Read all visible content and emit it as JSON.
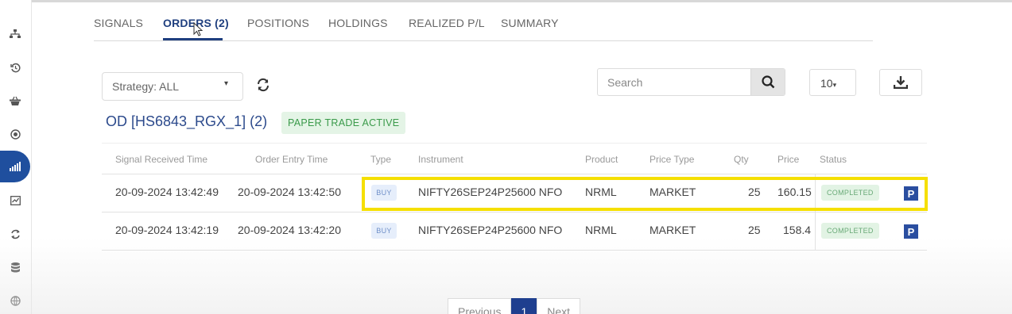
{
  "sidebar": {
    "icons": [
      "sitemap-icon",
      "history-icon",
      "basket-icon",
      "target-icon",
      "signal-bars-icon",
      "chart-box-icon",
      "sync-icon",
      "database-icon",
      "globe-icon"
    ],
    "active_index": 4
  },
  "tabs": [
    {
      "label": "SIGNALS"
    },
    {
      "label": "ORDERS (2)",
      "active": true
    },
    {
      "label": "POSITIONS"
    },
    {
      "label": "HOLDINGS"
    },
    {
      "label": "REALIZED P/L"
    },
    {
      "label": "SUMMARY"
    }
  ],
  "toolbar": {
    "strategy_label": "Strategy: ALL",
    "search_placeholder": "Search",
    "page_size": "10"
  },
  "group": {
    "title": "OD [HS6843_RGX_1] (2)",
    "badge": "PAPER TRADE ACTIVE"
  },
  "table": {
    "headers": {
      "signal_time": "Signal Received Time",
      "entry_time": "Order Entry Time",
      "type": "Type",
      "instrument": "Instrument",
      "product": "Product",
      "price_type": "Price Type",
      "qty": "Qty",
      "price": "Price",
      "status": "Status"
    },
    "rows": [
      {
        "signal_time": "20-09-2024 13:42:49",
        "entry_time": "20-09-2024 13:42:50",
        "type": "BUY",
        "instrument": "NIFTY26SEP24P25600",
        "exchange": "NFO",
        "product": "NRML",
        "price_type": "MARKET",
        "qty": "25",
        "price": "160.15",
        "status": "COMPLETED",
        "mode_icon": "P"
      },
      {
        "signal_time": "20-09-2024 13:42:19",
        "entry_time": "20-09-2024 13:42:20",
        "type": "BUY",
        "instrument": "NIFTY26SEP24P25600",
        "exchange": "NFO",
        "product": "NRML",
        "price_type": "MARKET",
        "qty": "25",
        "price": "158.4",
        "status": "COMPLETED",
        "mode_icon": "P"
      }
    ]
  },
  "pagination": {
    "previous": "Previous",
    "current": "1",
    "next": "Next"
  },
  "colors": {
    "accent": "#1f4f9e",
    "highlight": "#f5df00",
    "status_green": "#6aaa78"
  }
}
